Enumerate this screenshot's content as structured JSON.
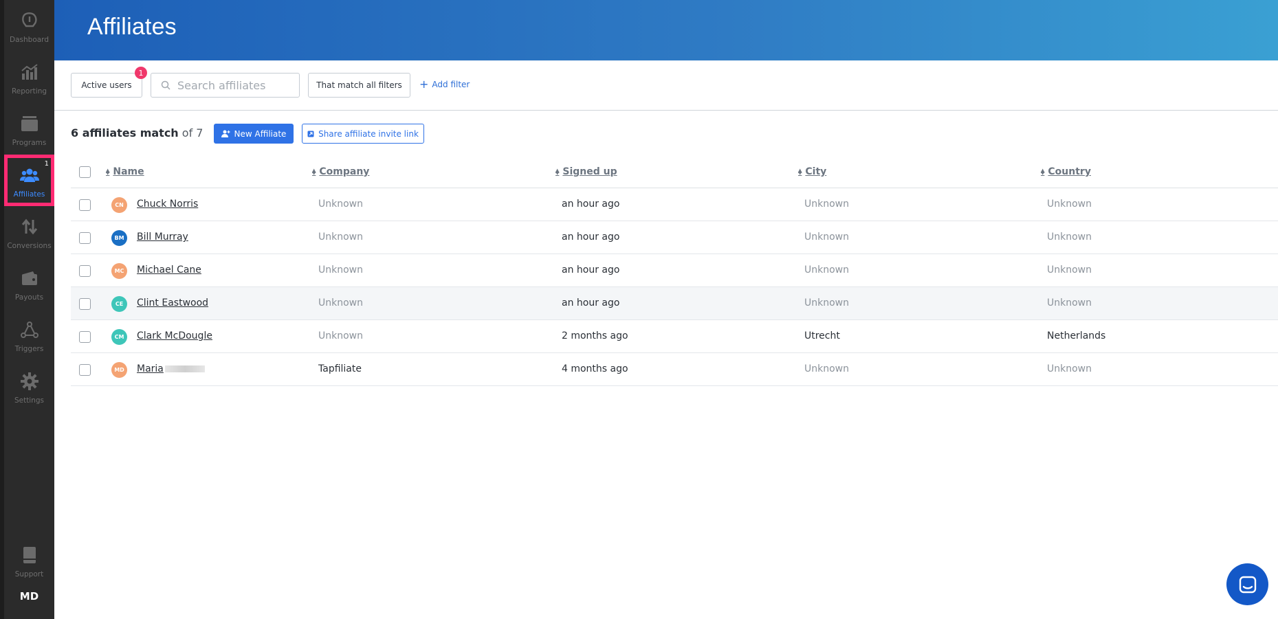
{
  "sidebar": {
    "items": [
      {
        "label": "Dashboard",
        "icon": "dashboard-icon"
      },
      {
        "label": "Reporting",
        "icon": "bar-chart-icon"
      },
      {
        "label": "Programs",
        "icon": "programs-icon"
      },
      {
        "label": "Affiliates",
        "icon": "users-icon",
        "badge": "1",
        "active": true
      },
      {
        "label": "Conversions",
        "icon": "arrows-up-down-icon"
      },
      {
        "label": "Payouts",
        "icon": "wallet-icon"
      },
      {
        "label": "Triggers",
        "icon": "triggers-icon"
      },
      {
        "label": "Settings",
        "icon": "gear-icon"
      }
    ],
    "support_label": "Support",
    "user_initials": "MD",
    "colors": {
      "active": "#3d8cff",
      "highlight": "#ff2b73"
    }
  },
  "header": {
    "title": "Affiliates"
  },
  "filters": {
    "active_users_label": "Active users",
    "active_users_count": "1",
    "search_placeholder": "Search affiliates",
    "match_label": "That match all filters",
    "add_filter_label": "Add filter"
  },
  "summary": {
    "match_text": "6 affiliates match",
    "total_text": "of 7",
    "new_affiliate_label": "New Affiliate",
    "share_label": "Share affiliate invite link"
  },
  "table": {
    "columns": [
      "Name",
      "Company",
      "Signed up",
      "City",
      "Country"
    ],
    "rows": [
      {
        "initials": "CN",
        "avatar_color": "#f4a373",
        "name": "Chuck Norris",
        "company": "Unknown",
        "signed_up": "an hour ago",
        "city": "Unknown",
        "country": "Unknown"
      },
      {
        "initials": "BM",
        "avatar_color": "#1a6fc4",
        "name": "Bill Murray",
        "company": "Unknown",
        "signed_up": "an hour ago",
        "city": "Unknown",
        "country": "Unknown"
      },
      {
        "initials": "MC",
        "avatar_color": "#f4a373",
        "name": "Michael Cane",
        "company": "Unknown",
        "signed_up": "an hour ago",
        "city": "Unknown",
        "country": "Unknown"
      },
      {
        "initials": "CE",
        "avatar_color": "#3ec6b9",
        "name": "Clint Eastwood",
        "company": "Unknown",
        "signed_up": "an hour ago",
        "city": "Unknown",
        "country": "Unknown"
      },
      {
        "initials": "CM",
        "avatar_color": "#3ec6b9",
        "name": "Clark McDougle",
        "company": "Unknown",
        "signed_up": "2 months ago",
        "city": "Utrecht",
        "country": "Netherlands"
      },
      {
        "initials": "MD",
        "avatar_color": "#f4a373",
        "name": "Maria",
        "company": "Tapfiliate",
        "signed_up": "4 months ago",
        "city": "Unknown",
        "country": "Unknown"
      }
    ]
  }
}
